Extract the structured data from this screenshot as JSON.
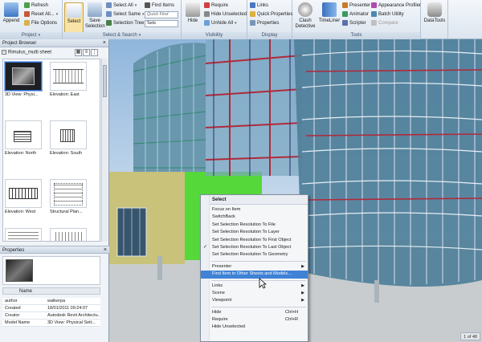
{
  "ribbon": {
    "project": {
      "label": "Project",
      "append": "Append",
      "refresh": "Refresh",
      "reset_all": "Reset All...",
      "file_options": "File Options"
    },
    "select_search": {
      "label": "Select & Search",
      "select": "Select",
      "save_selection": "Save Selection",
      "select_all": "Select All",
      "select_same": "Select Same",
      "selection_tree": "Selection Tree",
      "find_items": "Find Items",
      "quick_find_placeholder": "Quick Find",
      "sets": "Sets"
    },
    "visibility": {
      "label": "Visibility",
      "hide": "Hide",
      "require": "Require",
      "hide_unselected": "Hide Unselected",
      "unhide_all": "Unhide All"
    },
    "display": {
      "label": "Display",
      "links": "Links",
      "quick_properties": "Quick Properties",
      "properties": "Properties"
    },
    "tools": {
      "label": "Tools",
      "clash_detective": "Clash Detective",
      "timeliner": "TimeLiner",
      "presenter": "Presenter",
      "animator": "Animator",
      "scripter": "Scripter",
      "appearance_profiler": "Appearance Profiler",
      "batch_utility": "Batch Utility",
      "compare": "Compare",
      "datatools": "DataTools"
    },
    "colors": {
      "active_bg": "#f9e3a6",
      "accent": "#2b6cd0"
    }
  },
  "project_browser": {
    "title": "Project Browser",
    "root": "Rimulus_multi sheet",
    "sheets": [
      {
        "label": "3D View: Physi..."
      },
      {
        "label": "Elevation: East"
      },
      {
        "label": "Elevation: North"
      },
      {
        "label": "Elevation: South"
      },
      {
        "label": "Elevation: West"
      },
      {
        "label": "Structural Plan..."
      },
      {
        "label": ""
      },
      {
        "label": ""
      }
    ]
  },
  "properties": {
    "title": "Properties",
    "name_header": "Name",
    "rows": [
      {
        "k": "author",
        "v": "walkerpa"
      },
      {
        "k": "Created",
        "v": "18/01/2011 09:24:07"
      },
      {
        "k": "Creator",
        "v": "Autodesk Revit Architectu..."
      },
      {
        "k": "Model Name",
        "v": "3D View: Physical Sett..."
      }
    ]
  },
  "context_menu": {
    "header": "Select",
    "items": [
      {
        "label": "Focus on Item"
      },
      {
        "label": "SwitchBack"
      },
      {
        "label": "Set Selection Resolution To File"
      },
      {
        "label": "Set Selection Resolution To Layer"
      },
      {
        "label": "Set Selection Resolution To First Object"
      },
      {
        "label": "Set Selection Resolution To Last Object",
        "checked": true
      },
      {
        "label": "Set Selection Resolution To Geometry"
      }
    ],
    "group2": [
      {
        "label": "Presenter",
        "submenu": true
      },
      {
        "label": "Find Item in Other Sheets and Models...",
        "highlighted": true
      }
    ],
    "group3": [
      {
        "label": "Links",
        "submenu": true
      },
      {
        "label": "Scene",
        "submenu": true
      },
      {
        "label": "Viewpoint",
        "submenu": true
      }
    ],
    "group4": [
      {
        "label": "Hide",
        "shortcut": "Ctrl+H"
      },
      {
        "label": "Require",
        "shortcut": "Ctrl+R"
      },
      {
        "label": "Hide Unselected",
        "shortcut": ""
      }
    ],
    "highlight_color": "#3f82d6"
  },
  "status": {
    "sheet_counter": "1 of 48"
  }
}
